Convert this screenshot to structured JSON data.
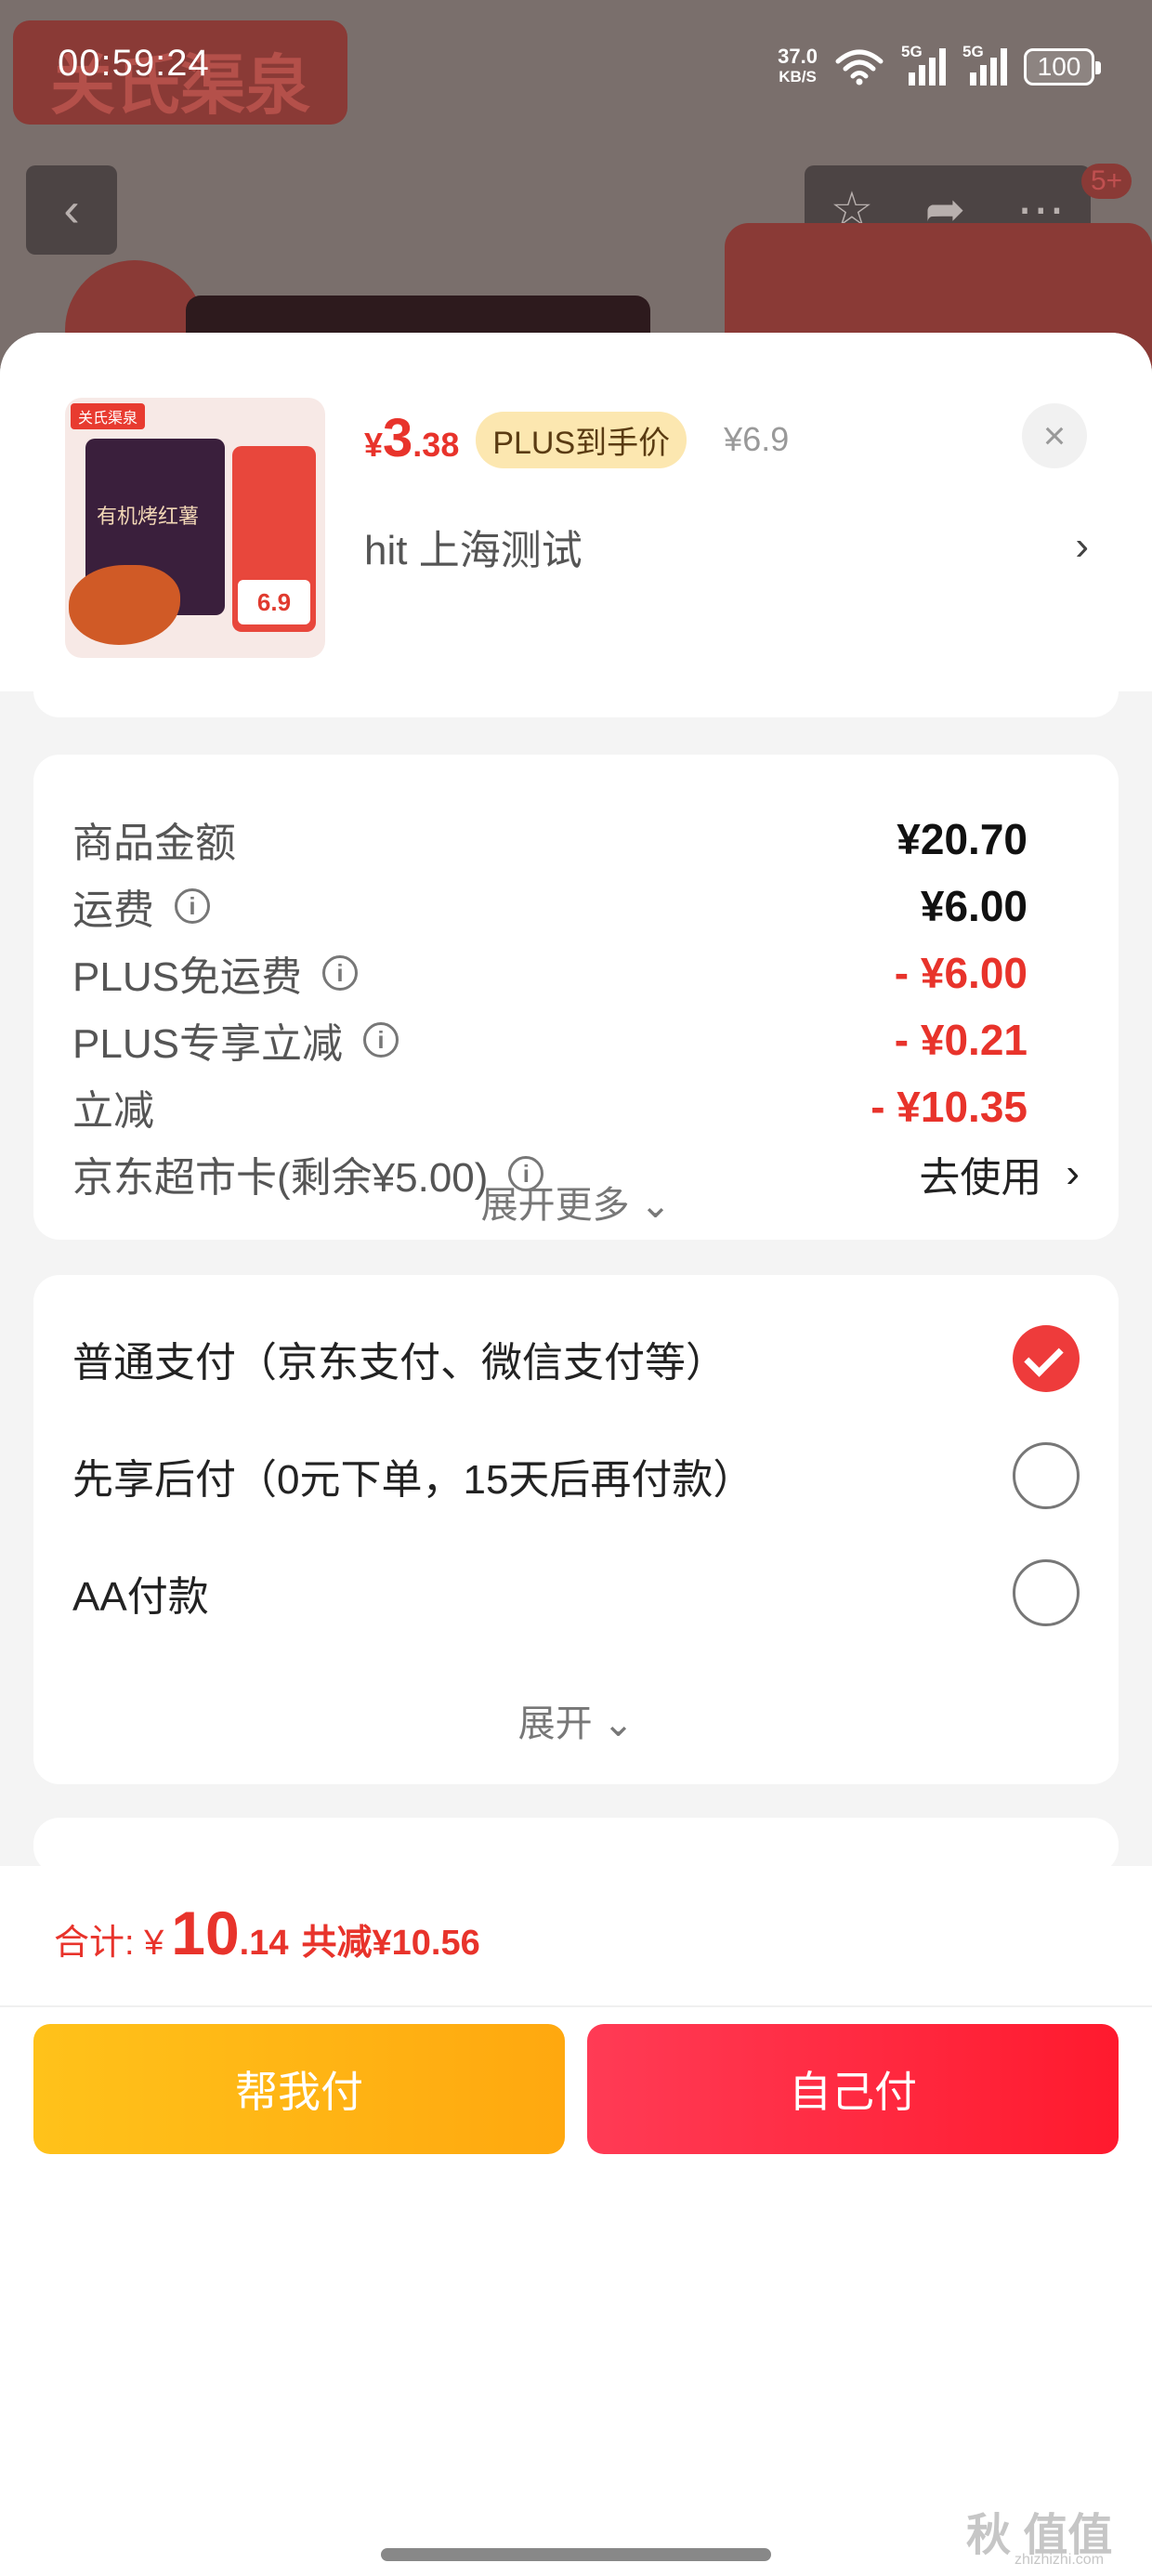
{
  "status_bar": {
    "time": "00:59:24",
    "net_speed": "37.0",
    "net_unit": "KB/S",
    "signal1": "5G",
    "signal2": "5G",
    "battery": "100"
  },
  "background": {
    "brand": "关氏渠泉",
    "badge": "5+"
  },
  "product": {
    "image_tag": "关氏渠泉",
    "image_title": "有机烤红薯",
    "image_price": "6.9",
    "currency": "¥",
    "price_int": "3",
    "price_dec": ".38",
    "plus_tag": "PLUS到手价",
    "original_price": "¥6.9",
    "address": "hit  上海测试"
  },
  "fees": {
    "items": [
      {
        "label": "商品金额",
        "value": "¥20.70"
      },
      {
        "label": "运费",
        "value": "¥6.00"
      },
      {
        "label": "PLUS免运费",
        "value": "- ¥6.00"
      },
      {
        "label": "PLUS专享立减",
        "value": "- ¥0.21"
      },
      {
        "label": "立减",
        "value": "- ¥10.35"
      }
    ],
    "card_label": "京东超市卡(剩余¥5.00)",
    "card_action": "去使用",
    "expand": "展开更多"
  },
  "payment": {
    "options": [
      {
        "label": "普通支付（京东支付、微信支付等）",
        "selected": true
      },
      {
        "label": "先享后付（0元下单，15天后再付款）",
        "selected": false
      },
      {
        "label": "AA付款",
        "selected": false
      }
    ],
    "expand": "展开"
  },
  "footer": {
    "total_label": "合计: ¥",
    "total_int": "10",
    "total_dec": ".14",
    "discount": "共减¥10.56",
    "help_pay": "帮我付",
    "self_pay": "自己付"
  },
  "watermark": {
    "text": "秋 值值值",
    "url": "zhizhizhi.com"
  },
  "colors": {
    "accent_red": "#e8332b",
    "help_button": "#ffb412",
    "self_button": "#ff2a42",
    "plus_tag_bg": "#fce7b0"
  }
}
